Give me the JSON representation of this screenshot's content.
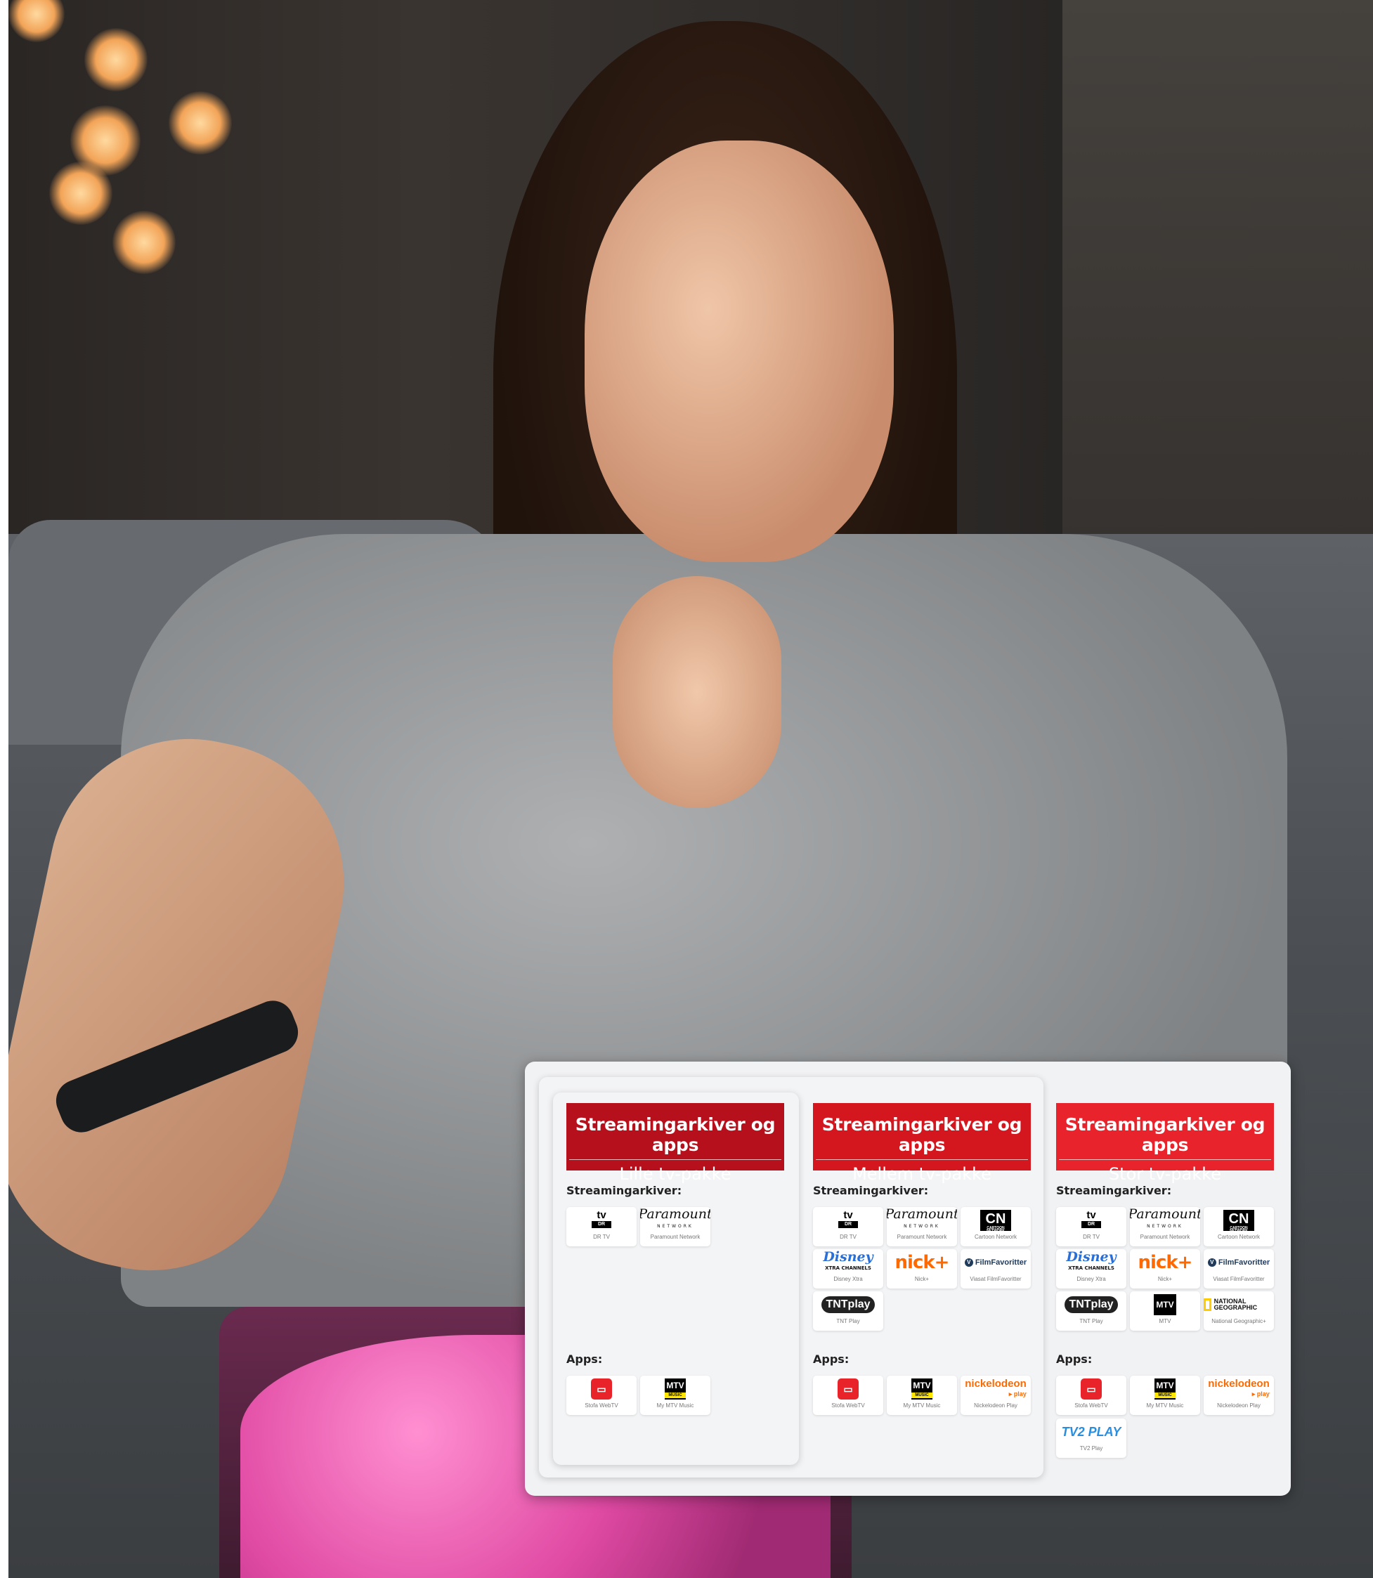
{
  "colors": {
    "small_head": "#b5101b",
    "medium_head": "#d4161f",
    "large_head": "#e8232b",
    "panel_bg": "#f1f2f4"
  },
  "packages": [
    {
      "title": "Streamingarkiver og apps",
      "subtitle": "Lille tv-pakke",
      "streaming_label": "Streamingarkiver:",
      "apps_label": "Apps:",
      "streaming": [
        {
          "icon": "dr-tv-logo",
          "caption": "DR TV"
        },
        {
          "icon": "paramount-logo",
          "caption": "Paramount Network"
        }
      ],
      "apps": [
        {
          "icon": "stofa-webtv-logo",
          "caption": "Stofa WebTV"
        },
        {
          "icon": "mtv-music-logo",
          "caption": "My MTV Music"
        }
      ]
    },
    {
      "title": "Streamingarkiver og apps",
      "subtitle": "Mellem tv-pakke",
      "streaming_label": "Streamingarkiver:",
      "apps_label": "Apps:",
      "streaming": [
        {
          "icon": "dr-tv-logo",
          "caption": "DR TV"
        },
        {
          "icon": "paramount-logo",
          "caption": "Paramount Network"
        },
        {
          "icon": "cartoon-network-logo",
          "caption": "Cartoon Network"
        },
        {
          "icon": "disney-xtra-logo",
          "caption": "Disney Xtra"
        },
        {
          "icon": "nick-plus-logo",
          "caption": "Nick+"
        },
        {
          "icon": "filmfavoritter-logo",
          "caption": "Viasat FilmFavoritter"
        },
        {
          "icon": "tnt-play-logo",
          "caption": "TNT Play"
        }
      ],
      "apps": [
        {
          "icon": "stofa-webtv-logo",
          "caption": "Stofa WebTV"
        },
        {
          "icon": "mtv-music-logo",
          "caption": "My MTV Music"
        },
        {
          "icon": "nickelodeon-play-logo",
          "caption": "Nickelodeon Play"
        }
      ]
    },
    {
      "title": "Streamingarkiver og apps",
      "subtitle": "Stor tv-pakke",
      "streaming_label": "Streamingarkiver:",
      "apps_label": "Apps:",
      "streaming": [
        {
          "icon": "dr-tv-logo",
          "caption": "DR TV"
        },
        {
          "icon": "paramount-logo",
          "caption": "Paramount Network"
        },
        {
          "icon": "cartoon-network-logo",
          "caption": "Cartoon Network"
        },
        {
          "icon": "disney-xtra-logo",
          "caption": "Disney Xtra"
        },
        {
          "icon": "nick-plus-logo",
          "caption": "Nick+"
        },
        {
          "icon": "filmfavoritter-logo",
          "caption": "Viasat FilmFavoritter"
        },
        {
          "icon": "tnt-play-logo",
          "caption": "TNT Play"
        },
        {
          "icon": "mtv-logo",
          "caption": "MTV"
        },
        {
          "icon": "national-geographic-logo",
          "caption": "National Geographic+"
        }
      ],
      "apps": [
        {
          "icon": "stofa-webtv-logo",
          "caption": "Stofa WebTV"
        },
        {
          "icon": "mtv-music-logo",
          "caption": "My MTV Music"
        },
        {
          "icon": "nickelodeon-play-logo",
          "caption": "Nickelodeon Play"
        },
        {
          "icon": "tv2-play-logo",
          "caption": "TV2 Play"
        }
      ]
    }
  ],
  "logo_text": {
    "dr_top": "tv",
    "dr_bottom": "DR",
    "paramount": "Paramount",
    "paramount_sub": "NETWORK",
    "cn": "CN",
    "cn_sub": "CARTOON NETWORK",
    "disney": "Disney",
    "disney_sub": "XTRA CHANNELS",
    "nick": "nick+",
    "filmfav": "FilmFavoritter",
    "tnt": "TNTplay",
    "mtv": "MTV",
    "mtv_music": "MUSIC",
    "natgeo": "NATIONAL GEOGRAPHIC",
    "nickplay": "nickelodeon",
    "nickplay_sub": "play",
    "tv2": "TV2 PLAY"
  }
}
